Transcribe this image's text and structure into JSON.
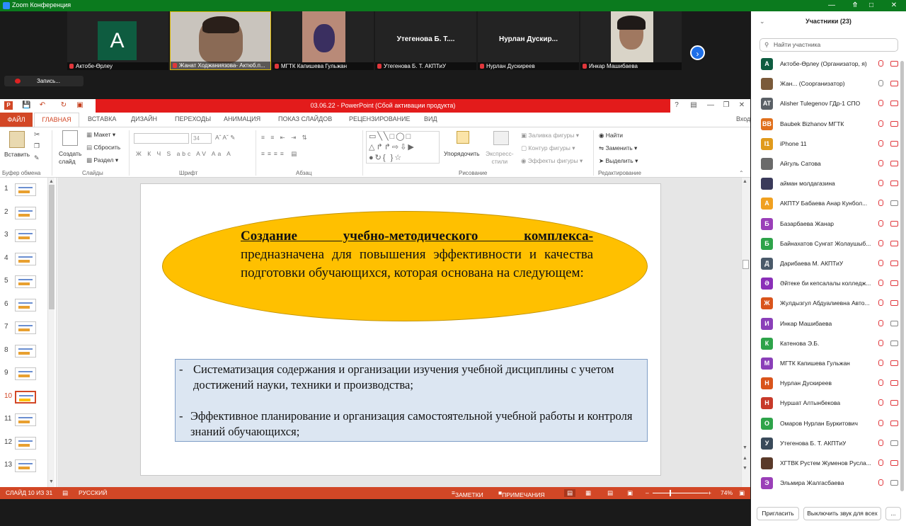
{
  "window": {
    "title": "Zoom Конференция"
  },
  "videos": [
    {
      "name": "Актобе-Өрлеу",
      "avatar_letter": "A",
      "type": "avatar"
    },
    {
      "name": "Жанат Ходжаниязова- Актюб.п...",
      "type": "video"
    },
    {
      "name": "МГТК Капишева Гульжан",
      "type": "video"
    },
    {
      "name": "Утегенова Б. Т. АКПТиУ",
      "big": "Утегенова Б. Т....",
      "type": "name"
    },
    {
      "name": "Нурлан Дускиреев",
      "big": "Нурлан Дускир...",
      "type": "name"
    },
    {
      "name": "Инкар Машибаева",
      "type": "video"
    }
  ],
  "record": {
    "label": "Запись..."
  },
  "ppt": {
    "title": "03.06.22 -  PowerPoint (Сбой активации продукта)",
    "tabs": [
      "ФАЙЛ",
      "ГЛАВНАЯ",
      "ВСТАВКА",
      "ДИЗАЙН",
      "ПЕРЕХОДЫ",
      "АНИМАЦИЯ",
      "ПОКАЗ СЛАЙДОВ",
      "РЕЦЕНЗИРОВАНИЕ",
      "ВИД"
    ],
    "signin": "Вход",
    "ribbon": {
      "paste": "Вставить",
      "new_slide": "Создать\nслайд",
      "layout": "Макет",
      "reset": "Сбросить",
      "section": "Раздел",
      "font_size": "34",
      "arrange": "Упорядочить",
      "quick_styles": "Экспресс-\nстили",
      "fill": "Заливка фигуры",
      "outline": "Контур фигуры",
      "effects": "Эффекты фигуры",
      "find": "Найти",
      "replace": "Заменить",
      "select": "Выделить",
      "groups": [
        "Буфер обмена",
        "Слайды",
        "Шрифт",
        "Абзац",
        "Рисование",
        "Редактирование"
      ]
    },
    "slide_numbers": [
      "1",
      "2",
      "3",
      "4",
      "5",
      "6",
      "7",
      "8",
      "9",
      "10",
      "11",
      "12",
      "13"
    ],
    "current_slide": 10,
    "slide": {
      "title_bold": "Создание учебно-методического комплекса-",
      "title_rest": " предназначена для повышения эффективности и качества подготовки обучающихся, которая основана на следующем:",
      "bullets": [
        "Систематизация содержания и организации изучения учебной дисциплины с учетом достижений науки, техники и производства;",
        "Эффективное планирование и организация самостоятельной учебной работы и контроля знаний обучающихся;"
      ]
    },
    "status": {
      "slide": "СЛАЙД 10 ИЗ 31",
      "lang": "РУССКИЙ",
      "notes": "ЗАМЕТКИ",
      "comments": "ПРИМЕЧАНИЯ",
      "zoom": "74%",
      "zoom_value": 74
    }
  },
  "participants_panel": {
    "title": "Участники (23)",
    "search_placeholder": "Найти участника",
    "invite": "Пригласить",
    "mute_all": "Выключить звук для всех",
    "more": "...",
    "people": [
      {
        "av": "А",
        "color": "#0e5c40",
        "name": "Актобе-Өрлеу (Организатор, я)"
      },
      {
        "av": "",
        "color": "#7a5a3a",
        "name": "Жан...  (Соорганизатор)"
      },
      {
        "av": "AT",
        "color": "#5a6066",
        "name": "Alisher Tulegenov ГДр-1 СПО"
      },
      {
        "av": "BB",
        "color": "#e0701c",
        "name": "Baubek Bizhanov МГТК"
      },
      {
        "av": "I1",
        "color": "#e09a1c",
        "name": "iPhone 11"
      },
      {
        "av": "",
        "color": "#6a6a6a",
        "name": "Айгуль Сатова"
      },
      {
        "av": "",
        "color": "#3a3a5a",
        "name": "айман молдагазина"
      },
      {
        "av": "А",
        "color": "#f0a020",
        "name": "АКПТУ Бабаева Анар Кунбол..."
      },
      {
        "av": "Б",
        "color": "#9a3fb8",
        "name": "Базарбаева Жанар"
      },
      {
        "av": "Б",
        "color": "#2ea34a",
        "name": "Байнахатов Сунгат Жолаушыб..."
      },
      {
        "av": "Д",
        "color": "#4a5a6a",
        "name": "Дарибаева М. АКПТиУ"
      },
      {
        "av": "Ә",
        "color": "#8a2fb8",
        "name": "Әйтеке би кепсалалы колледж..."
      },
      {
        "av": "Ж",
        "color": "#d9541c",
        "name": "Жулдызгул Абдуалиевна Авто..."
      },
      {
        "av": "И",
        "color": "#8a3fb8",
        "name": "Инкар Машибаева"
      },
      {
        "av": "К",
        "color": "#2ea34a",
        "name": "Катенова Э.Б."
      },
      {
        "av": "М",
        "color": "#8a3fb8",
        "name": "МГТК Капишева Гульжан"
      },
      {
        "av": "Н",
        "color": "#d9541c",
        "name": "Нурлан Дускиреев"
      },
      {
        "av": "Н",
        "color": "#c73a2a",
        "name": "Нуршат Алтынбекова"
      },
      {
        "av": "О",
        "color": "#2ea34a",
        "name": "Омаров Нурлан Буркитович"
      },
      {
        "av": "У",
        "color": "#3a4a5a",
        "name": "Утегенова Б. Т. АКПТиУ"
      },
      {
        "av": "",
        "color": "#5a3a2a",
        "name": "ХГТВК  Рустем Жуменов Русла..."
      },
      {
        "av": "Э",
        "color": "#9a3fb8",
        "name": "Эльмира Жалгасбаева"
      }
    ]
  }
}
